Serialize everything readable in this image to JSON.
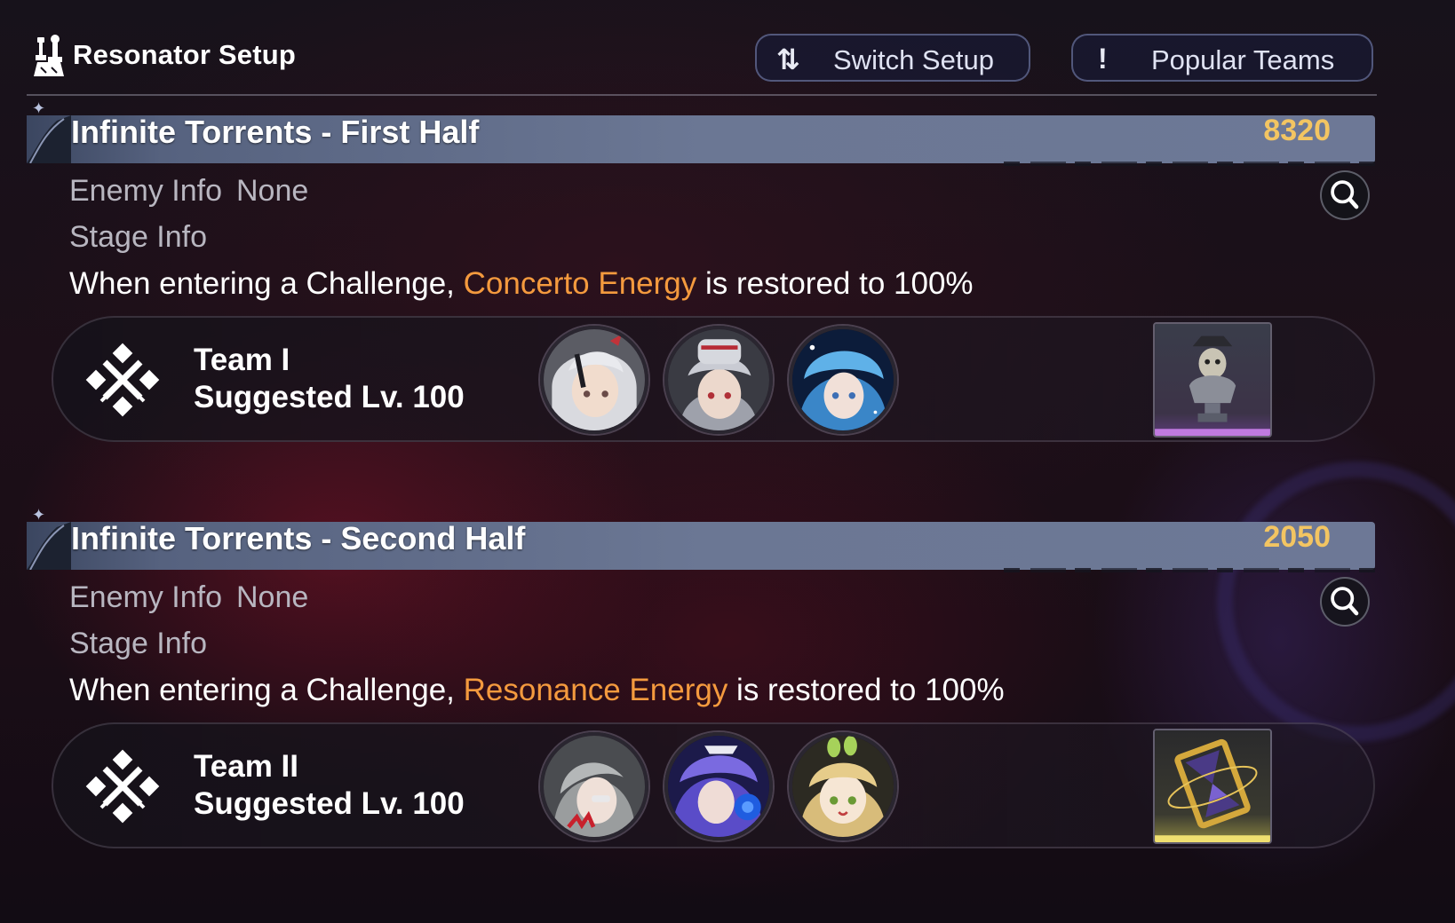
{
  "header": {
    "title": "Resonator Setup",
    "switch_setup": {
      "icon": "swap-arrows-icon",
      "label": "Switch Setup"
    },
    "popular_teams": {
      "icon": "exclamation-icon",
      "label": "Popular Teams"
    }
  },
  "sections": [
    {
      "title": "Infinite Torrents - First Half",
      "score": "8320",
      "enemy_info_label": "Enemy Info",
      "enemy_info_value": "None",
      "stage_info_label": "Stage Info",
      "description": {
        "before": "When entering a Challenge, ",
        "highlight": "Concerto Energy",
        "after": " is restored to 100%"
      },
      "team": {
        "name": "Team I",
        "level": "Suggested Lv. 100",
        "members": [
          "resonator-portrait-1",
          "resonator-portrait-2",
          "resonator-portrait-3"
        ],
        "echo": "skull-bust-echo-icon"
      }
    },
    {
      "title": "Infinite Torrents - Second Half",
      "score": "2050",
      "enemy_info_label": "Enemy Info",
      "enemy_info_value": "None",
      "stage_info_label": "Stage Info",
      "description": {
        "before": "When entering a Challenge, ",
        "highlight": "Resonance Energy",
        "after": " is restored to 100%"
      },
      "team": {
        "name": "Team II",
        "level": "Suggested Lv. 100",
        "members": [
          "resonator-portrait-4",
          "resonator-portrait-5",
          "resonator-portrait-6"
        ],
        "echo": "hourglass-echo-icon"
      }
    }
  ],
  "colors": {
    "highlight": "#f49a3e",
    "score": "#f3c562",
    "section_bar": "#6b7794",
    "echo_rarity_purple": "#c07ae0",
    "echo_rarity_gold": "#f0e070"
  }
}
